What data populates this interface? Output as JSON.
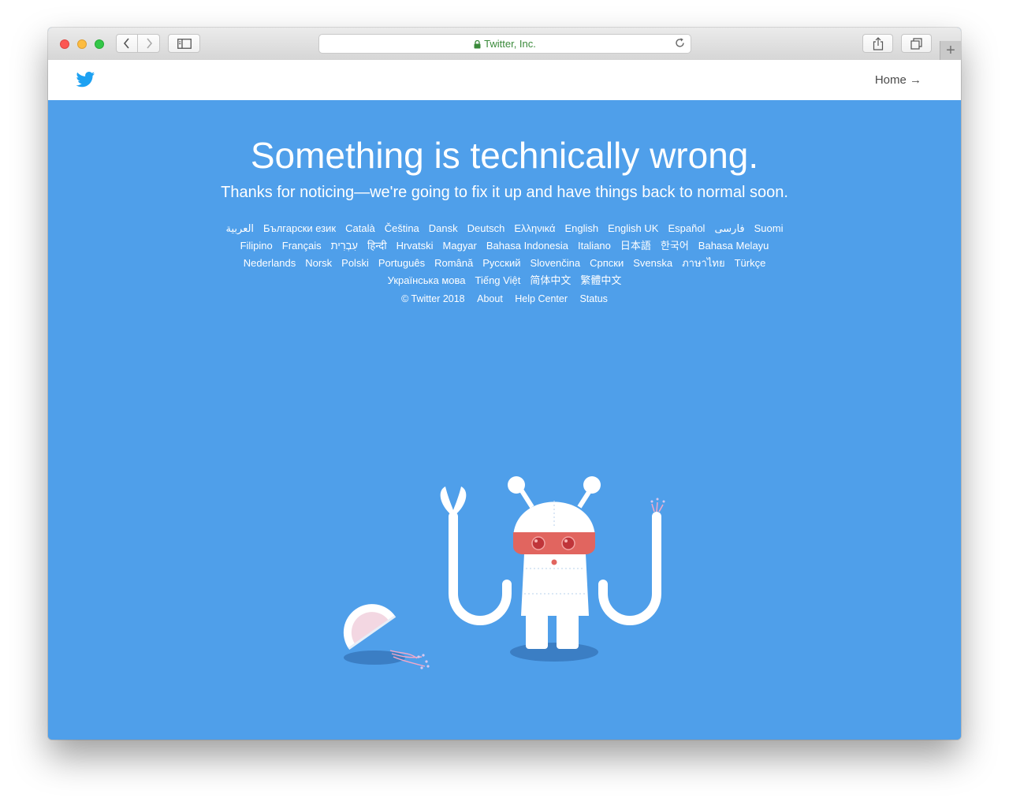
{
  "browser": {
    "address": "Twitter, Inc.",
    "newtab_symbol": "+"
  },
  "header": {
    "home_link": "Home →"
  },
  "main": {
    "headline": "Something is technically wrong.",
    "subhead": "Thanks for noticing—we're going to fix it up and have things back to normal soon."
  },
  "languages": [
    "العربية",
    "Български език",
    "Català",
    "Čeština",
    "Dansk",
    "Deutsch",
    "Ελληνικά",
    "English",
    "English UK",
    "Español",
    "فارسی",
    "Suomi",
    "Filipino",
    "Français",
    "עִבְרִית",
    "हिन्दी",
    "Hrvatski",
    "Magyar",
    "Bahasa Indonesia",
    "Italiano",
    "日本語",
    "한국어",
    "Bahasa Melayu",
    "Nederlands",
    "Norsk",
    "Polski",
    "Português",
    "Română",
    "Русский",
    "Slovenčina",
    "Српски",
    "Svenska",
    "ภาษาไทย",
    "Türkçe",
    "Українська мова",
    "Tiếng Việt",
    "简体中文",
    "繁體中文"
  ],
  "footer": {
    "copyright": "© Twitter 2018",
    "about": "About",
    "help": "Help Center",
    "status": "Status"
  },
  "colors": {
    "twitter_blue": "#4f9fea",
    "bird_blue": "#1da1f2"
  },
  "icons": {
    "back": "chevron-left-icon",
    "forward": "chevron-right-icon",
    "sidebar": "sidebar-icon",
    "lock": "lock-icon",
    "reload": "reload-icon",
    "share": "share-icon",
    "tabs": "tabs-icon",
    "logo": "twitter-bird-icon"
  }
}
